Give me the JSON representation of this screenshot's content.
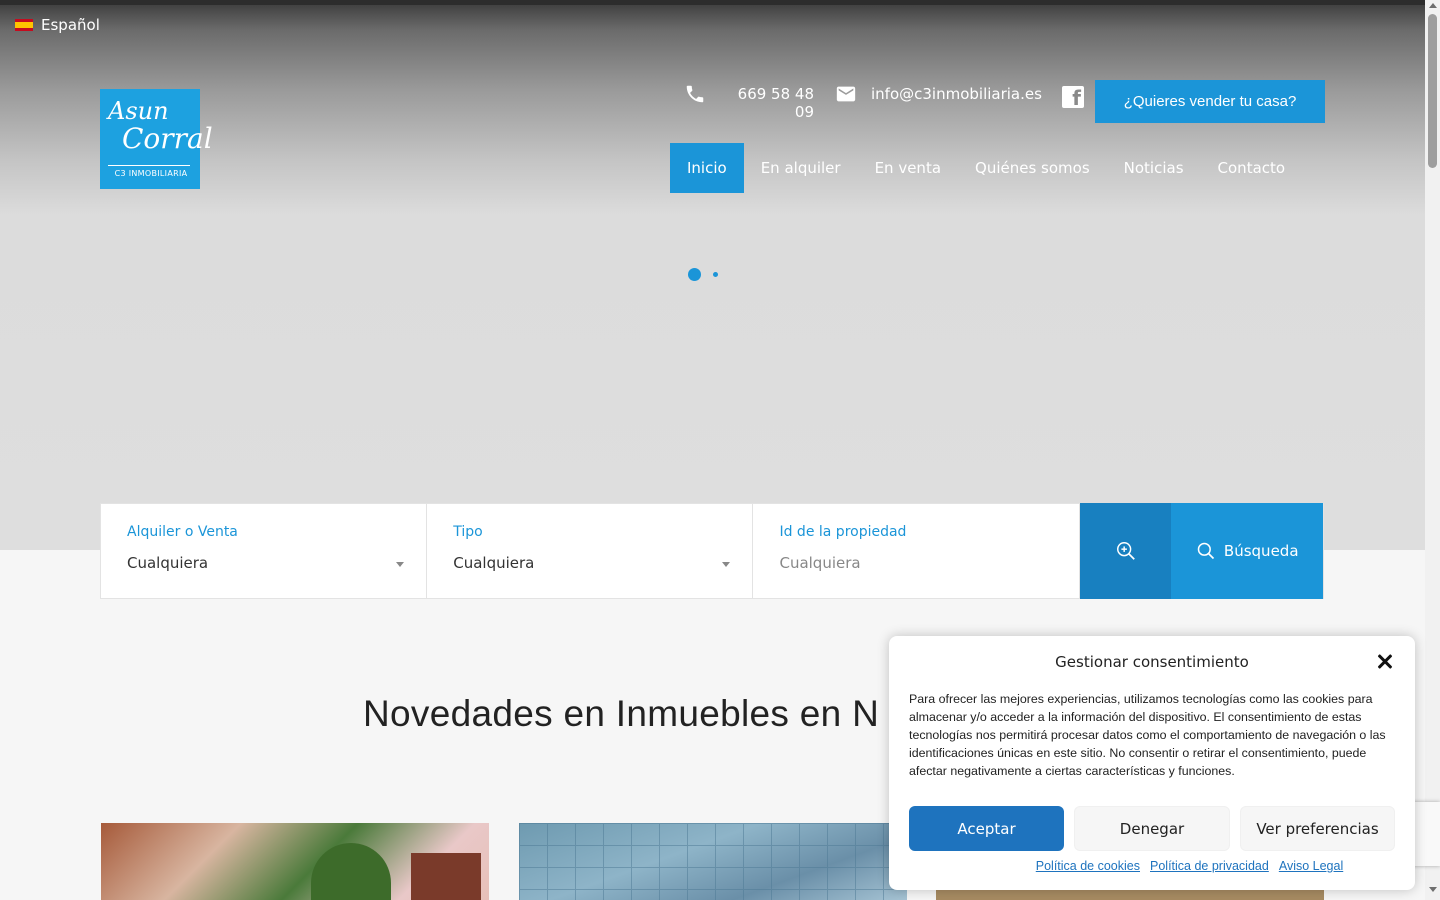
{
  "language": {
    "label": "Español"
  },
  "logo": {
    "line1": "Asun",
    "line2": "Corral",
    "line3": "C3 INMOBILIARIA"
  },
  "header": {
    "phone": "669 58 48 09",
    "email": "info@c3inmobiliaria.es",
    "sell_button": "¿Quieres vender tu casa?"
  },
  "nav": {
    "items": [
      {
        "label": "Inicio"
      },
      {
        "label": "En alquiler"
      },
      {
        "label": "En venta"
      },
      {
        "label": "Quiénes somos"
      },
      {
        "label": "Noticias"
      },
      {
        "label": "Contacto"
      }
    ]
  },
  "search": {
    "fields": [
      {
        "label": "Alquiler o Venta",
        "value": "Cualquiera"
      },
      {
        "label": "Tipo",
        "value": "Cualquiera"
      },
      {
        "label": "Id de la propiedad",
        "placeholder": "Cualquiera"
      }
    ],
    "search_button": "Búsqueda"
  },
  "section": {
    "title": "Novedades en Inmuebles en N"
  },
  "consent": {
    "title": "Gestionar consentimiento",
    "body": "Para ofrecer las mejores experiencias, utilizamos tecnologías como las cookies para almacenar y/o acceder a la información del dispositivo. El consentimiento de estas tecnologías nos permitirá procesar datos como el comportamiento de navegación o las identificaciones únicas en este sitio. No consentir o retirar el consentimiento, puede afectar negativamente a ciertas características y funciones.",
    "accept": "Aceptar",
    "deny": "Denegar",
    "preferences": "Ver preferencias",
    "links": [
      "Política de cookies",
      "Política de privacidad",
      "Aviso Legal"
    ]
  },
  "colors": {
    "accent": "#1b95d8",
    "consent_primary": "#1e73be"
  }
}
